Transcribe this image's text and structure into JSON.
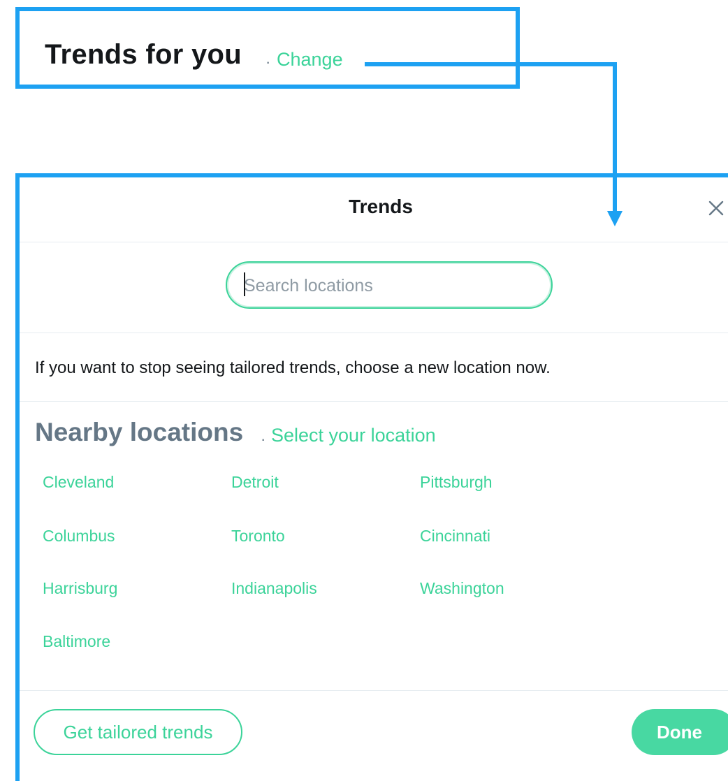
{
  "header": {
    "title": "Trends for you",
    "separator": "·",
    "change_label": "Change"
  },
  "modal": {
    "title": "Trends",
    "close_icon": "close-icon",
    "search": {
      "placeholder": "Search locations",
      "value": ""
    },
    "info_text": "If you want to stop seeing tailored trends, choose a new location now.",
    "nearby_heading": "Nearby locations",
    "separator": "·",
    "select_location_label": "Select your location",
    "locations": [
      "Cleveland",
      "Detroit",
      "Pittsburgh",
      "Columbus",
      "Toronto",
      "Cincinnati",
      "Harrisburg",
      "Indianapolis",
      "Washington",
      "Baltimore"
    ],
    "tailored_button_label": "Get tailored trends",
    "done_button_label": "Done"
  },
  "colors": {
    "accent": "#3bd399",
    "annotation": "#1da1f2",
    "done_bg": "#48d8a2",
    "muted": "#657786"
  }
}
